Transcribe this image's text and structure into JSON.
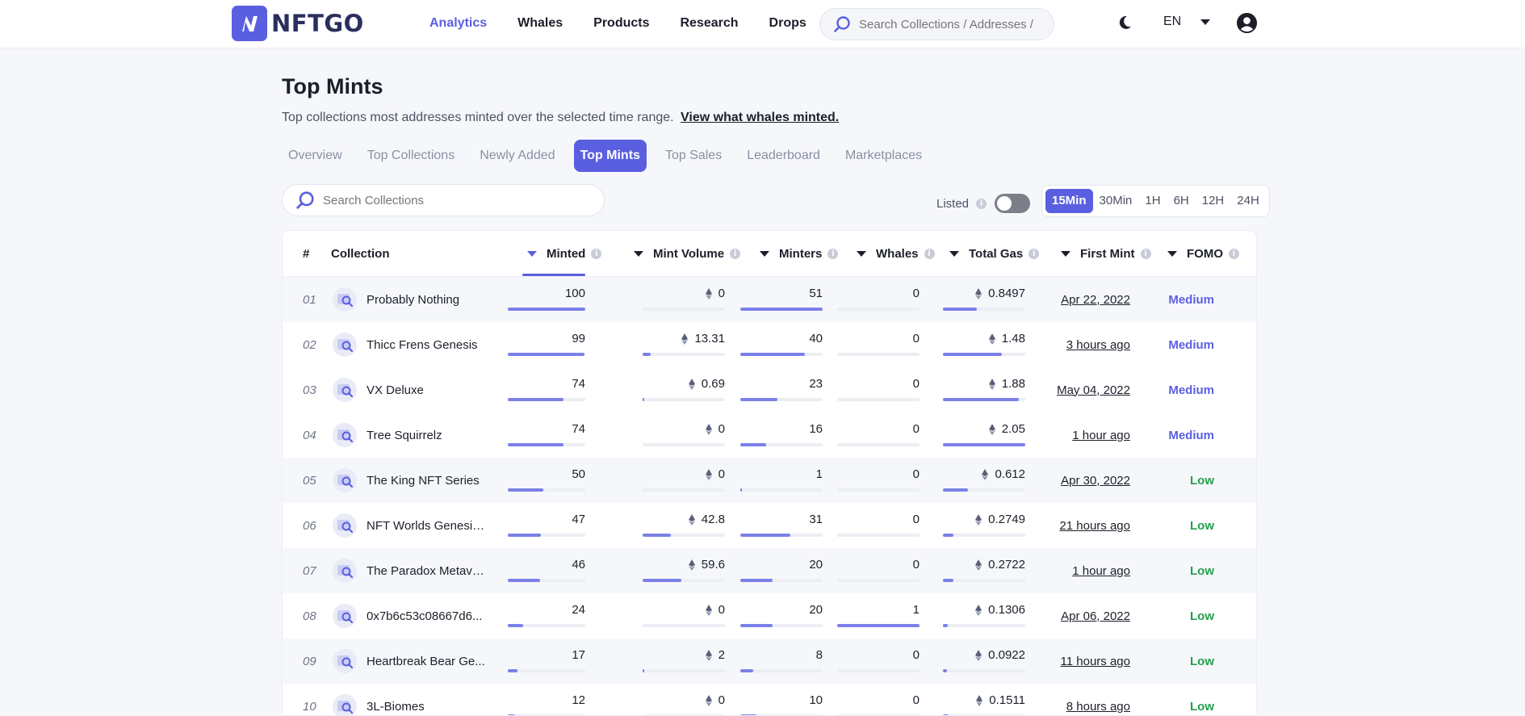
{
  "brand": {
    "name": "NFTGO",
    "accent": "#5a5fe0"
  },
  "nav": {
    "items": [
      "Analytics",
      "Whales",
      "Products",
      "Research",
      "Drops"
    ],
    "active": "Analytics",
    "search_placeholder": "Search Collections / Addresses /",
    "lang": "EN"
  },
  "page": {
    "title": "Top Mints",
    "description": "Top collections most addresses minted over the selected time range.",
    "link": "View what whales minted."
  },
  "tabs": [
    "Overview",
    "Top Collections",
    "Newly Added",
    "Top Mints",
    "Top Sales",
    "Leaderboard",
    "Marketplaces"
  ],
  "active_tab": "Top Mints",
  "controls": {
    "search_placeholder": "Search Collections",
    "listed_label": "Listed",
    "listed_on": false,
    "ranges": [
      "15Min",
      "30Min",
      "1H",
      "6H",
      "12H",
      "24H"
    ],
    "active_range": "15Min"
  },
  "table": {
    "headers": {
      "rank": "#",
      "collection": "Collection",
      "minted": "Minted",
      "mint_volume": "Mint Volume",
      "minters": "Minters",
      "whales": "Whales",
      "total_gas": "Total Gas",
      "first_mint": "First Mint",
      "fomo": "FOMO"
    },
    "sorted_by": "Minted",
    "fomo_colors": {
      "Medium": "#5a5fe0",
      "Low": "#23a04d"
    },
    "rows": [
      {
        "rank": "01",
        "name": "Probably Nothing",
        "minted": "100",
        "minted_pct": 100,
        "volume": "0",
        "volume_pct": 0,
        "minters": "51",
        "minters_pct": 100,
        "whales": "0",
        "whales_pct": 0,
        "gas": "0.8497",
        "gas_pct": 41,
        "first_mint": "Apr 22, 2022",
        "fomo": "Medium"
      },
      {
        "rank": "02",
        "name": "Thicc Frens Genesis",
        "minted": "99",
        "minted_pct": 99,
        "volume": "13.31",
        "volume_pct": 10,
        "minters": "40",
        "minters_pct": 78,
        "whales": "0",
        "whales_pct": 0,
        "gas": "1.48",
        "gas_pct": 72,
        "first_mint": "3 hours ago",
        "fomo": "Medium"
      },
      {
        "rank": "03",
        "name": "VX Deluxe",
        "minted": "74",
        "minted_pct": 72,
        "volume": "0.69",
        "volume_pct": 1,
        "minters": "23",
        "minters_pct": 45,
        "whales": "0",
        "whales_pct": 0,
        "gas": "1.88",
        "gas_pct": 92,
        "first_mint": "May 04, 2022",
        "fomo": "Medium"
      },
      {
        "rank": "04",
        "name": "Tree Squirrelz",
        "minted": "74",
        "minted_pct": 72,
        "volume": "0",
        "volume_pct": 0,
        "minters": "16",
        "minters_pct": 31,
        "whales": "0",
        "whales_pct": 0,
        "gas": "2.05",
        "gas_pct": 100,
        "first_mint": "1 hour ago",
        "fomo": "Medium"
      },
      {
        "rank": "05",
        "name": "The King NFT Series",
        "minted": "50",
        "minted_pct": 46,
        "volume": "0",
        "volume_pct": 0,
        "minters": "1",
        "minters_pct": 2,
        "whales": "0",
        "whales_pct": 0,
        "gas": "0.612",
        "gas_pct": 30,
        "first_mint": "Apr 30, 2022",
        "fomo": "Low"
      },
      {
        "rank": "06",
        "name": "NFT Worlds Genesis ...",
        "minted": "47",
        "minted_pct": 43,
        "volume": "42.8",
        "volume_pct": 34,
        "minters": "31",
        "minters_pct": 61,
        "whales": "0",
        "whales_pct": 0,
        "gas": "0.2749",
        "gas_pct": 13,
        "first_mint": "21 hours ago",
        "fomo": "Low"
      },
      {
        "rank": "07",
        "name": "The Paradox Metave...",
        "minted": "46",
        "minted_pct": 42,
        "volume": "59.6",
        "volume_pct": 47,
        "minters": "20",
        "minters_pct": 39,
        "whales": "0",
        "whales_pct": 0,
        "gas": "0.2722",
        "gas_pct": 13,
        "first_mint": "1 hour ago",
        "fomo": "Low"
      },
      {
        "rank": "08",
        "name": "0x7b6c53c08667d6...",
        "minted": "24",
        "minted_pct": 20,
        "volume": "0",
        "volume_pct": 0,
        "minters": "20",
        "minters_pct": 39,
        "whales": "1",
        "whales_pct": 100,
        "gas": "0.1306",
        "gas_pct": 6,
        "first_mint": "Apr 06, 2022",
        "fomo": "Low"
      },
      {
        "rank": "09",
        "name": "Heartbreak Bear Ge...",
        "minted": "17",
        "minted_pct": 13,
        "volume": "2",
        "volume_pct": 2,
        "minters": "8",
        "minters_pct": 16,
        "whales": "0",
        "whales_pct": 0,
        "gas": "0.0922",
        "gas_pct": 5,
        "first_mint": "11 hours ago",
        "fomo": "Low"
      },
      {
        "rank": "10",
        "name": "3L-Biomes",
        "minted": "12",
        "minted_pct": 9,
        "volume": "0",
        "volume_pct": 0,
        "minters": "10",
        "minters_pct": 20,
        "whales": "0",
        "whales_pct": 0,
        "gas": "0.1511",
        "gas_pct": 7,
        "first_mint": "8 hours ago",
        "fomo": "Low"
      }
    ]
  }
}
